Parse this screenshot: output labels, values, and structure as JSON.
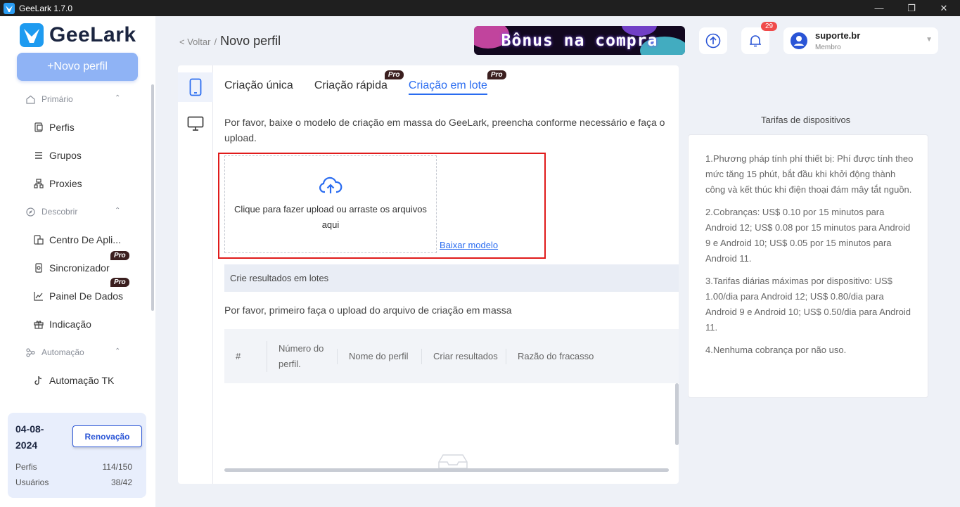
{
  "window": {
    "title": "GeeLark 1.7.0",
    "brand_color": "#2a6cf0"
  },
  "sidebar": {
    "logo_text": "GeeLark",
    "new_profile_label": "+Novo perfil",
    "sections": [
      {
        "label": "Primário",
        "icon": "home-icon",
        "items": [
          {
            "label": "Perfis",
            "icon": "profile-icon"
          },
          {
            "label": "Grupos",
            "icon": "list-icon"
          },
          {
            "label": "Proxies",
            "icon": "network-icon"
          }
        ]
      },
      {
        "label": "Descobrir",
        "icon": "compass-icon",
        "items": [
          {
            "label": "Centro De Apli...",
            "icon": "apps-icon"
          },
          {
            "label": "Sincronizador",
            "icon": "sync-icon",
            "badge": "Pro"
          },
          {
            "label": "Painel De Dados",
            "icon": "chart-icon",
            "badge": "Pro"
          },
          {
            "label": "Indicação",
            "icon": "gift-icon"
          }
        ]
      },
      {
        "label": "Automação",
        "icon": "automation-icon",
        "items": [
          {
            "label": "Automação TK",
            "icon": "tiktok-icon"
          }
        ]
      }
    ],
    "plan": {
      "date": "04-08-2024",
      "renew_label": "Renovação",
      "profiles_label": "Perfis",
      "profiles_value": "114/150",
      "users_label": "Usuários",
      "users_value": "38/42"
    }
  },
  "header": {
    "back_label": "< Voltar",
    "separator": "/",
    "title": "Novo perfil",
    "banner_text": "Bônus na compra",
    "notification_count": "29",
    "user_name": "suporte.br",
    "user_role": "Membro"
  },
  "main": {
    "tabs": [
      {
        "label": "Criação única",
        "pro": false,
        "active": false
      },
      {
        "label": "Criação rápida",
        "pro": true,
        "active": false
      },
      {
        "label": "Criação em lote",
        "pro": true,
        "active": true
      }
    ],
    "pro_label": "Pro",
    "description": "Por favor, baixe o modelo de criação em massa do GeeLark, preencha conforme necessário e faça o upload.",
    "upload_text": "Clique para fazer upload ou arraste os arquivos aqui",
    "download_template_label": "Baixar modelo",
    "results_bar_label": "Crie resultados em lotes",
    "results_note": "Por favor, primeiro faça o upload do arquivo de criação em massa",
    "table_columns": [
      "#",
      "Número do perfil.",
      "Nome do perfil",
      "Criar resultados",
      "Razão do fracasso"
    ]
  },
  "right_panel": {
    "title": "Tarifas de dispositivos",
    "paragraphs": [
      "1.Phương pháp tính phí thiết bị: Phí được tính theo mức tăng 15 phút, bắt đầu khi khởi động thành công và kết thúc khi điện thoại đám mây tắt nguồn.",
      "2.Cobranças: US$ 0.10 por 15 minutos para Android 12; US$ 0.08 por 15 minutos para Android 9 e Android 10; US$ 0.05 por 15 minutos para Android 11.",
      "3.Tarifas diárias máximas por dispositivo: US$ 1.00/dia para Android 12; US$ 0.80/dia para Android 9 e Android 10; US$ 0.50/dia para Android 11.",
      "4.Nenhuma cobrança por não uso."
    ]
  }
}
